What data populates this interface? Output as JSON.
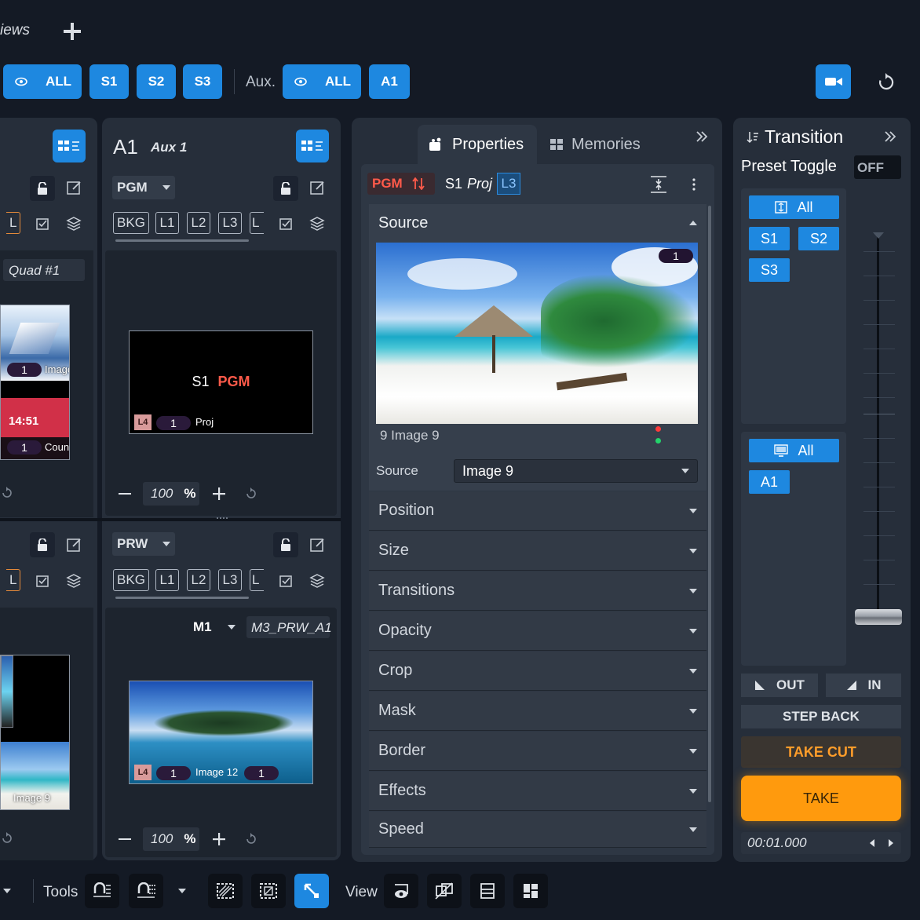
{
  "header": {
    "views_label": "iews",
    "add_icon": "plus-icon"
  },
  "selector": {
    "all_label": "ALL",
    "screens": [
      "S1",
      "S2",
      "S3"
    ],
    "aux_label": "Aux.",
    "aux_all_label": "ALL",
    "aux_items": [
      "A1"
    ]
  },
  "left_panel": {
    "layer_partial": "L",
    "quad_label": "Quad #1",
    "thumb1": {
      "num": "1",
      "label": "Image"
    },
    "thumb2": {
      "time": "14:51",
      "num": "1",
      "label": "Count"
    },
    "thumb3_label": "Image 9"
  },
  "a1_panel": {
    "title": "A1",
    "subtitle": "Aux 1",
    "pgm_select": "PGM",
    "prw_select": "PRW",
    "layers": [
      "BKG",
      "L1",
      "L2",
      "L3",
      "L"
    ],
    "pgm_preview": {
      "screen": "S1",
      "pgm": "PGM",
      "layer": "L4",
      "num": "1",
      "label": "Proj"
    },
    "prw_preview": {
      "layer": "L4",
      "num": "1",
      "label": "Image 12",
      "num2": "1"
    },
    "memory_select": "M1",
    "memory_name": "M3_PRW_A1",
    "zoom": "100",
    "zoom_unit": "%"
  },
  "properties": {
    "tab_properties": "Properties",
    "tab_memories": "Memories",
    "pgm_badge": "PGM",
    "screen": "S1",
    "layer_name": "Proj",
    "layer_badge": "L3",
    "source_section": "Source",
    "source_badge": "1",
    "source_caption": "9 Image 9",
    "source_field_label": "Source",
    "source_field_value": "Image 9",
    "sections": [
      "Position",
      "Size",
      "Transitions",
      "Opacity",
      "Crop",
      "Mask",
      "Border",
      "Effects",
      "Speed"
    ]
  },
  "transition": {
    "title": "Transition",
    "preset_toggle_label": "Preset Toggle",
    "preset_toggle_value": "OFF",
    "screen_all": "All",
    "screens": [
      "S1",
      "S2",
      "S3"
    ],
    "aux_all": "All",
    "aux": [
      "A1"
    ],
    "out_label": "OUT",
    "in_label": "IN",
    "step_back": "STEP BACK",
    "take_cut": "TAKE CUT",
    "take": "TAKE",
    "duration": "00:01.000"
  },
  "toolbar": {
    "tools_label": "Tools",
    "view_label": "View"
  },
  "colors": {
    "accent": "#1e88e0",
    "pgm_red": "#ff5a4a",
    "take_orange": "#ff9a0d",
    "take_cut_text": "#ff9d2a"
  }
}
